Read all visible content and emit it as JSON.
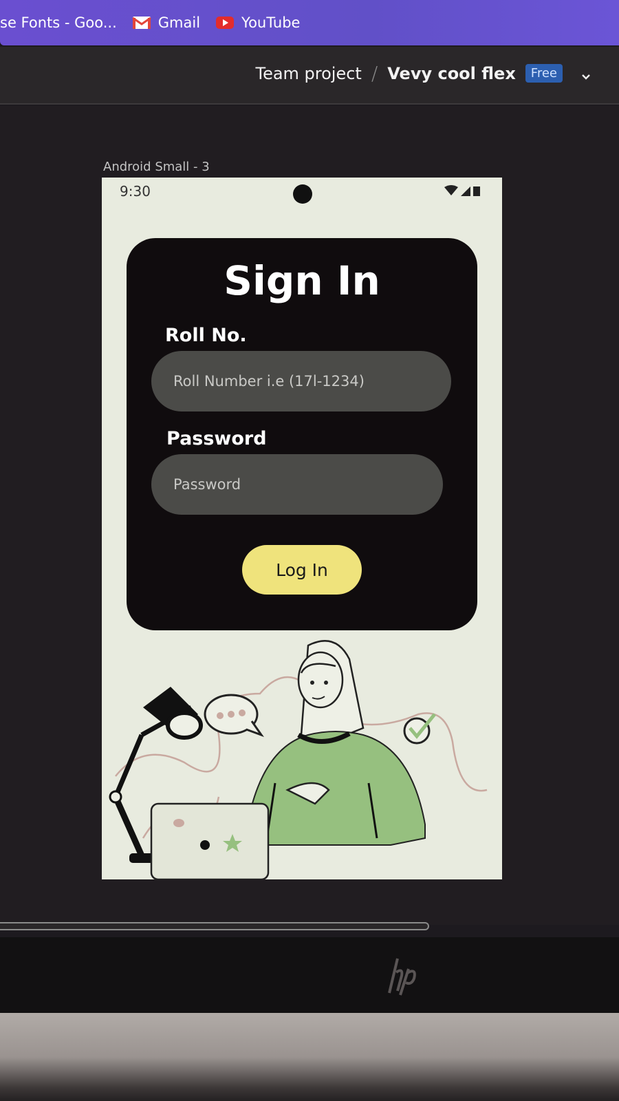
{
  "browser": {
    "bookmarks": [
      {
        "label": "se Fonts - Goo...",
        "icon": "google-fonts-icon"
      },
      {
        "label": "Gmail",
        "icon": "gmail-icon"
      },
      {
        "label": "YouTube",
        "icon": "youtube-icon"
      }
    ]
  },
  "figma": {
    "breadcrumb": {
      "team": "Team project",
      "separator": "/",
      "file": "Vevy cool flex",
      "plan_badge": "Free"
    },
    "frame_label": "Android Small - 3"
  },
  "phone": {
    "status_time": "9:30",
    "signin": {
      "title": "Sign In",
      "roll_label": "Roll No.",
      "roll_placeholder": "Roll Number i.e (17l-1234)",
      "password_label": "Password",
      "password_placeholder": "Password",
      "login_button": "Log In"
    }
  },
  "colors": {
    "card_bg": "#100c0e",
    "field_bg": "#4b4b48",
    "button_bg": "#efe37c",
    "phone_bg": "#e8ebdf",
    "illustration_green": "#96c07f",
    "illustration_pink": "#c9a9a0"
  }
}
